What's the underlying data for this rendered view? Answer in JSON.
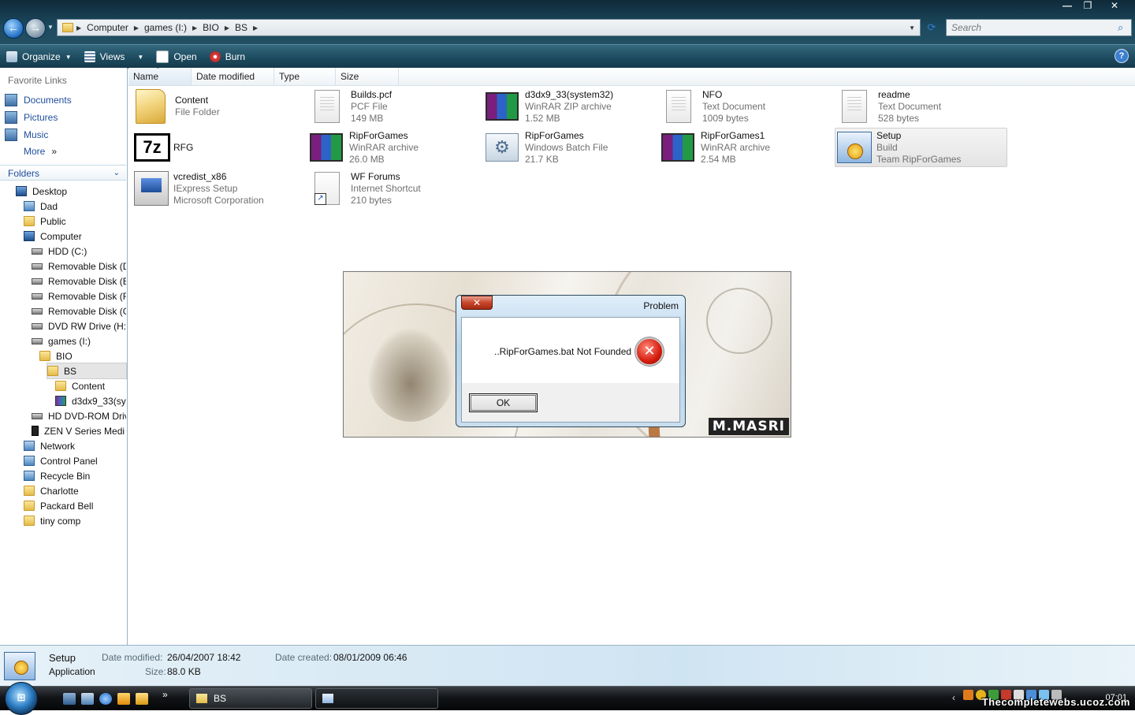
{
  "window": {
    "controls": {
      "minimize": "—",
      "restore": "❐",
      "close": "✕"
    }
  },
  "address": {
    "segments": [
      "Computer",
      "games (I:)",
      "BIO",
      "BS"
    ],
    "search_placeholder": "Search"
  },
  "toolbar": {
    "organize": "Organize",
    "views": "Views",
    "open": "Open",
    "burn": "Burn",
    "help": "?"
  },
  "nav": {
    "favorites_header": "Favorite Links",
    "favorites": [
      "Documents",
      "Pictures",
      "Music",
      "More"
    ],
    "more_chevron": "»",
    "folders_header": "Folders",
    "tree": [
      {
        "label": "Desktop",
        "icon": "desktop-icon",
        "level": 0
      },
      {
        "label": "Dad",
        "icon": "user-folder-icon",
        "level": 1
      },
      {
        "label": "Public",
        "icon": "folder-icon",
        "level": 1
      },
      {
        "label": "Computer",
        "icon": "computer-icon",
        "level": 1
      },
      {
        "label": "HDD (C:)",
        "icon": "hard-drive-icon",
        "level": 2
      },
      {
        "label": "Removable Disk (D",
        "icon": "removable-disk-icon",
        "level": 2
      },
      {
        "label": "Removable Disk (E",
        "icon": "removable-disk-icon",
        "level": 2
      },
      {
        "label": "Removable Disk (F",
        "icon": "removable-disk-icon",
        "level": 2
      },
      {
        "label": "Removable Disk (G",
        "icon": "removable-disk-icon",
        "level": 2
      },
      {
        "label": "DVD RW Drive (H:)",
        "icon": "dvd-drive-icon",
        "level": 2
      },
      {
        "label": "games (I:)",
        "icon": "hard-drive-icon",
        "level": 2
      },
      {
        "label": "BIO",
        "icon": "folder-icon",
        "level": 3
      },
      {
        "label": "BS",
        "icon": "folder-open-icon",
        "level": 4
      },
      {
        "label": "Content",
        "icon": "folder-icon",
        "level": 5
      },
      {
        "label": "d3dx9_33(sys",
        "icon": "winrar-icon",
        "level": 5
      },
      {
        "label": "HD DVD-ROM Driv",
        "icon": "dvd-drive-icon",
        "level": 2
      },
      {
        "label": "ZEN V Series Medi",
        "icon": "media-player-icon",
        "level": 2
      },
      {
        "label": "Network",
        "icon": "network-icon",
        "level": 1
      },
      {
        "label": "Control Panel",
        "icon": "control-panel-icon",
        "level": 1
      },
      {
        "label": "Recycle Bin",
        "icon": "recycle-bin-icon",
        "level": 1
      },
      {
        "label": "Charlotte",
        "icon": "folder-icon",
        "level": 1
      },
      {
        "label": "Packard Bell",
        "icon": "folder-icon",
        "level": 1
      },
      {
        "label": "tiny comp",
        "icon": "folder-icon",
        "level": 1
      }
    ]
  },
  "columns": [
    "Name",
    "Date modified",
    "Type",
    "Size"
  ],
  "files": [
    {
      "name": "Content",
      "line2": "File Folder",
      "line3": "",
      "icon": "folder"
    },
    {
      "name": "Builds.pcf",
      "line2": "PCF File",
      "line3": "149 MB",
      "icon": "doc"
    },
    {
      "name": "d3dx9_33(system32)",
      "line2": "WinRAR ZIP archive",
      "line3": "1.52 MB",
      "icon": "rar"
    },
    {
      "name": "NFO",
      "line2": "Text Document",
      "line3": "1009 bytes",
      "icon": "doc"
    },
    {
      "name": "readme",
      "line2": "Text Document",
      "line3": "528 bytes",
      "icon": "doc"
    },
    {
      "name": "RFG",
      "line2": "",
      "line3": "",
      "icon": "7z"
    },
    {
      "name": "RipForGames",
      "line2": "WinRAR archive",
      "line3": "26.0 MB",
      "icon": "rar"
    },
    {
      "name": "RipForGames",
      "line2": "Windows Batch File",
      "line3": "21.7 KB",
      "icon": "bat"
    },
    {
      "name": "RipForGames1",
      "line2": "WinRAR archive",
      "line3": "2.54 MB",
      "icon": "rar"
    },
    {
      "name": "Setup",
      "line2": "Build",
      "line3": "Team RipForGames",
      "icon": "setup"
    },
    {
      "name": "vcredist_x86",
      "line2": "IExpress Setup",
      "line3": "Microsoft Corporation",
      "icon": "vcred"
    },
    {
      "name": "WF Forums",
      "line2": "Internet Shortcut",
      "line3": "210 bytes",
      "icon": "url"
    }
  ],
  "splash": {
    "brand": "M.MASRI"
  },
  "dialog": {
    "title": "Problem",
    "close": "✕",
    "message": "..RipForGames.bat Not Founded",
    "error_glyph": "✕",
    "ok": "OK"
  },
  "details": {
    "name": "Setup",
    "kind": "Application",
    "date_modified_label": "Date modified:",
    "date_modified": "26/04/2007 18:42",
    "size_label": "Size:",
    "size": "88.0 KB",
    "date_created_label": "Date created:",
    "date_created": "08/01/2009 06:46"
  },
  "taskbar": {
    "quicklaunch_more": "»",
    "buttons": [
      {
        "label": "BS"
      },
      {
        "label": ""
      }
    ],
    "tray_expand": "‹",
    "clock": "07:01",
    "watermark": "Thecompletewebs.ucoz.com"
  }
}
